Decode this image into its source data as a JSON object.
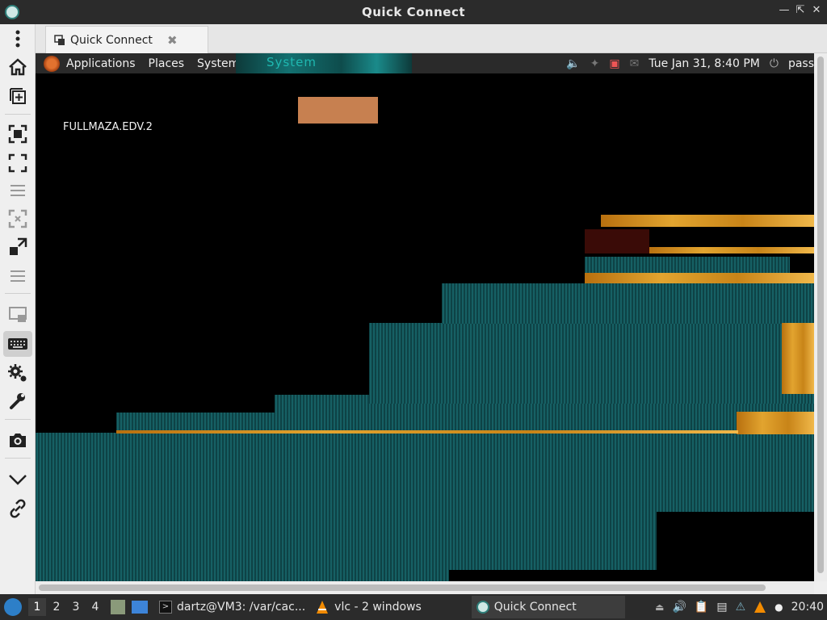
{
  "window": {
    "title": "Quick Connect"
  },
  "tab": {
    "label": "Quick Connect"
  },
  "remote": {
    "panel_menus": [
      "Applications",
      "Places",
      "System"
    ],
    "glitch_text": "System",
    "clock": "Tue Jan 31,  8:40 PM",
    "user": "pass",
    "host_label": "FULLMAZA.EDV.2"
  },
  "taskbar": {
    "workspaces": [
      "1",
      "2",
      "3",
      "4"
    ],
    "active_workspace": "1",
    "tasks": [
      {
        "label": "dartz@VM3: /var/cac...",
        "icon": "terminal-icon"
      },
      {
        "label": "vlc - 2 windows",
        "icon": "vlc-icon"
      },
      {
        "label": "Quick Connect",
        "icon": "remmina-icon"
      }
    ],
    "time": "20:40"
  },
  "toolbar_icons": [
    "more-options-icon",
    "home-icon",
    "new-connection-icon",
    "fit-window-icon",
    "fullscreen-icon",
    "menu-lines-icon",
    "dynamic-resize-icon",
    "scale-icon",
    "menu-lines-icon",
    "multi-monitor-icon",
    "keyboard-grab-icon",
    "preferences-icon",
    "tools-icon",
    "screenshot-icon",
    "minimize-toolbar-icon",
    "disconnect-icon"
  ]
}
